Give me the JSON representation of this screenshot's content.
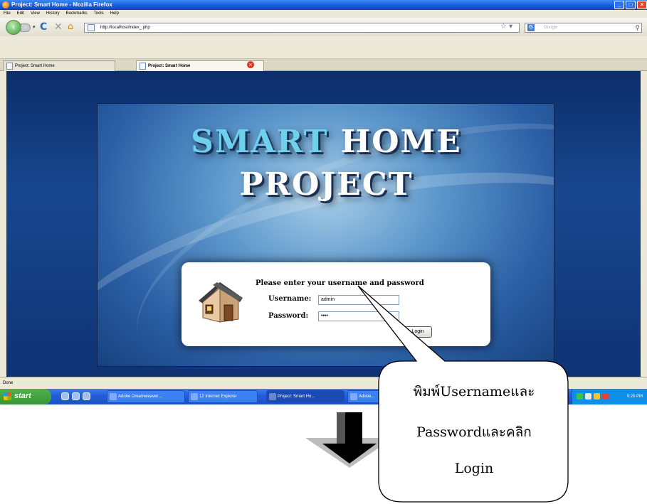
{
  "window": {
    "title": "Project: Smart Home - Mozilla Firefox",
    "controls": [
      "_",
      "□",
      "×"
    ]
  },
  "menu": [
    "File",
    "Edit",
    "View",
    "History",
    "Bookmarks",
    "Tools",
    "Help"
  ],
  "nav": {
    "url": "http://localhost/index_.php",
    "search_placeholder": "Google"
  },
  "tabs": [
    {
      "label": "Project: Smart Home"
    },
    {
      "label": "Project: Smart Home"
    }
  ],
  "page": {
    "logo_line1_a": "SMART",
    "logo_line1_b": "HOME",
    "logo_line2": "PROJECT",
    "login": {
      "heading": "Please enter your username and password",
      "username_label": "Username:",
      "username_value": "admin",
      "password_label": "Password:",
      "password_value": "••••",
      "button_label": "Login"
    }
  },
  "status": "Done",
  "taskbar": {
    "start": "start",
    "tasks": [
      {
        "label": "Adobe Dreamweaver ..."
      },
      {
        "label": "12 Internet Explorer"
      },
      {
        "label": "Project: Smart Ho..."
      },
      {
        "label": "Adobe..."
      }
    ],
    "clock": "9:26 PM"
  },
  "callout": {
    "line1": "พิมพ์Usernameและ",
    "line2": "Passwordและคลิก",
    "line3": "Login"
  },
  "colors": {
    "titlebar": "#1757d6",
    "page_background": "#18478f",
    "logo_accent": "#6fd0ec",
    "taskbar": "#245edb",
    "start_button": "#3a9436"
  }
}
